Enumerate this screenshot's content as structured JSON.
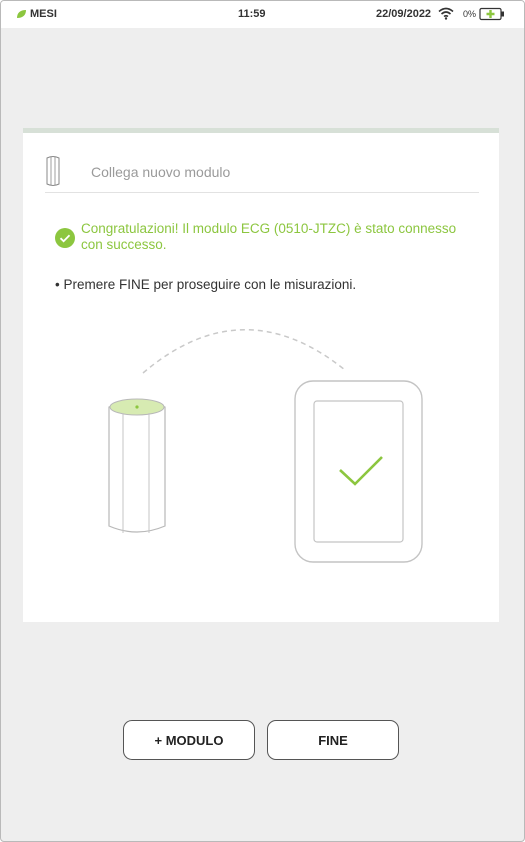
{
  "statusbar": {
    "brand": "MESI",
    "time": "11:59",
    "date": "22/09/2022",
    "battery_percent": "0%",
    "icons": [
      "mesi-leaf-icon",
      "wifi-icon",
      "battery-charging-icon"
    ]
  },
  "card": {
    "title": "Collega nuovo modulo",
    "success_message": "Congratulazioni! Il modulo ECG (0510-JTZC) è stato connesso con successo.",
    "instruction": "• Premere FINE per proseguire con le misurazioni."
  },
  "buttons": {
    "add_module": "+ MODULO",
    "finish": "FINE"
  },
  "colors": {
    "accent_green": "#8cc63f",
    "background": "#eeeeee",
    "card": "#ffffff"
  }
}
